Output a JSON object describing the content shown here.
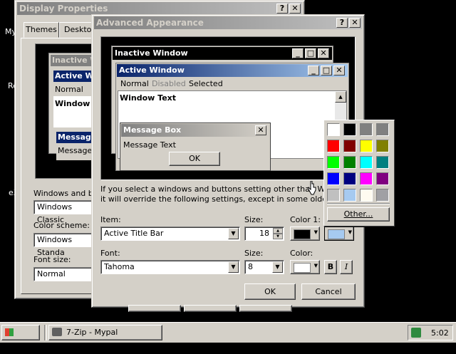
{
  "desktop": {
    "icon_labels": [
      "My",
      "Re",
      "eX"
    ]
  },
  "display_properties": {
    "title": "Display Properties",
    "tabs": [
      "Themes",
      "Desktop"
    ],
    "preview_inactive": "Inactive W",
    "preview_active": "Active W",
    "preview_normal": "Normal",
    "preview_window_text": "Window T",
    "preview_msgbox": "Messag",
    "preview_message": "Message",
    "windows_buttons_label": "Windows and butt",
    "windows_buttons_value": "Windows Classic",
    "color_scheme_label": "Color scheme:",
    "color_scheme_value": "Windows Standa",
    "font_size_label": "Font size:",
    "font_size_value": "Normal"
  },
  "advanced": {
    "title": "Advanced Appearance",
    "preview": {
      "inactive_title": "Inactive Window",
      "active_title": "Active Window",
      "menu_normal": "Normal",
      "menu_disabled": "Disabled",
      "menu_selected": "Selected",
      "window_text": "Window Text",
      "msgbox_title": "Message Box",
      "msgbox_text": "Message Text",
      "ok": "OK"
    },
    "hint_line1": "If you select a windows and buttons setting other than Windo",
    "hint_line2": "it will override the following settings, except in some older progra",
    "item_label": "Item:",
    "item_value": "Active Title Bar",
    "size_label": "Size:",
    "size_value": "18",
    "color1_label": "Color 1:",
    "font_label": "Font:",
    "font_value": "Tahoma",
    "font_size_label": "Size:",
    "font_size_value": "8",
    "color_label": "Color:",
    "bold": "B",
    "italic": "I",
    "ok": "OK",
    "cancel": "Cancel"
  },
  "palette": {
    "colors": [
      "#ffffff",
      "#000000",
      "#808080",
      "#808080",
      "#ff0000",
      "#800000",
      "#ffff00",
      "#808000",
      "#00ff00",
      "#008000",
      "#00ffff",
      "#008080",
      "#0000ff",
      "#000080",
      "#ff00ff",
      "#800080",
      "#c0c0c0",
      "#a6caf0",
      "#fffbf0",
      "#a0a0a4"
    ],
    "other": "Other..."
  },
  "taskbar": {
    "start": "Start",
    "task": "7-Zip - Mypal",
    "clock": "5:02"
  }
}
